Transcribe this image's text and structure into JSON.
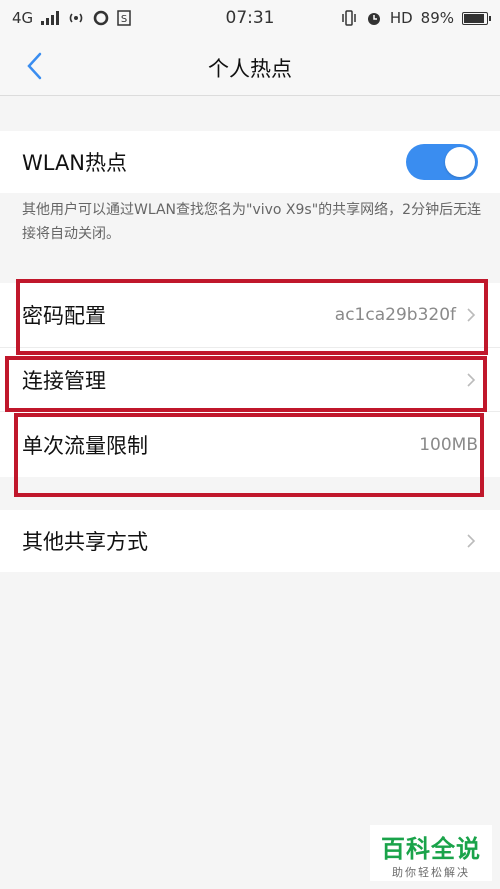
{
  "status_bar": {
    "network": "4G",
    "time": "07:31",
    "hd": "HD",
    "battery": "89%"
  },
  "header": {
    "title": "个人热点",
    "back_icon": "chevron-left-icon"
  },
  "wlan_hotspot": {
    "label": "WLAN热点",
    "enabled": true,
    "hint": "其他用户可以通过WLAN查找您名为\"vivo X9s\"的共享网络，2分钟后无连接将自动关闭。"
  },
  "settings": {
    "password": {
      "label": "密码配置",
      "value": "ac1ca29b320f"
    },
    "connection": {
      "label": "连接管理"
    },
    "data_limit": {
      "label": "单次流量限制",
      "value": "100MB"
    },
    "other_sharing": {
      "label": "其他共享方式"
    }
  },
  "watermark": {
    "title": "百科全说",
    "subtitle": "助你轻松解决"
  },
  "colors": {
    "accent": "#3a8df0",
    "highlight": "#c0172b",
    "brand_green": "#1aa34a"
  }
}
